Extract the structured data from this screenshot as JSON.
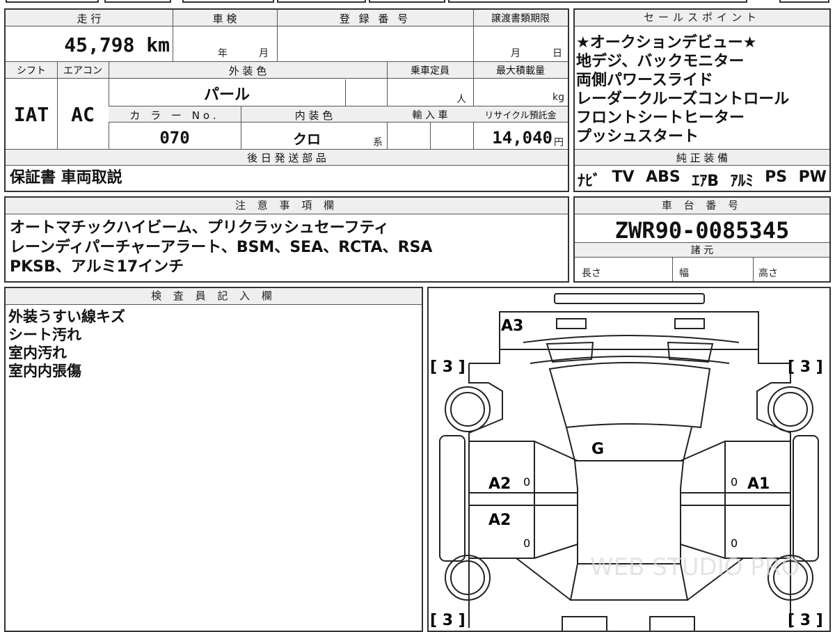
{
  "top_strip": {
    "title_fragment": "■■■"
  },
  "spec": {
    "mileage_label": "走 行",
    "mileage": "45,798 km",
    "inspection_label": "車 検",
    "inspection_year": "年",
    "inspection_month": "月",
    "registration_label": "登 録 番 号",
    "transfer_label": "譲渡書類期限",
    "transfer_month": "月",
    "transfer_day": "日",
    "shift_label": "シフト",
    "shift": "IAT",
    "ac_label": "エアコン",
    "ac": "AC",
    "exterior_label": "外 装 色",
    "exterior": "パール",
    "capacity_label": "乗車定員",
    "capacity_unit": "人",
    "max_load_label": "最大積載量",
    "max_load_unit": "kg",
    "color_no_label": "カ ラ ー No.",
    "color_no": "070",
    "interior_label": "内 装 色",
    "interior": "クロ",
    "interior_suffix": "系",
    "import_label": "輸 入 車",
    "recycle_label": "リサイクル預託金",
    "recycle_value": "14,040",
    "recycle_unit": "円"
  },
  "later_parts": {
    "label": "後 日 発 送 部 品",
    "value": "保証書 車両取説"
  },
  "sales": {
    "label": "セールスポイント",
    "lines": [
      "★オークションデビュー★",
      "地デジ、バックモニター",
      "両側パワースライド",
      "レーダークルーズコントロール",
      "フロントシートヒーター",
      "プッシュスタート"
    ]
  },
  "equipment": {
    "label": "純 正 装 備",
    "items": [
      "ﾅﾋﾞ",
      "TV",
      "ABS",
      "ｴｱB",
      "ｱﾙﾐ",
      "PS",
      "PW"
    ]
  },
  "notes": {
    "label": "注 意 事 項 欄",
    "lines": [
      "オートマチックハイビーム、プリクラッシュセーフティ",
      "レーンディパーチャーアラート、BSM、SEA、RCTA、RSA",
      "PKSB、アルミ17インチ"
    ]
  },
  "chassis": {
    "label": "車 台 番 号",
    "number": "ZWR90-0085345",
    "specs_label": "諸 元",
    "length_label": "長さ",
    "width_label": "幅",
    "height_label": "高さ"
  },
  "inspector": {
    "label": "検 査 員 記 入 欄",
    "lines": [
      "外装うすい線キズ",
      "シート汚れ",
      "室内汚れ",
      "室内内張傷"
    ]
  },
  "diagram": {
    "marks": {
      "rear": "A3",
      "roof": "G",
      "left_front_door": "A2",
      "left_rear_door": "A2",
      "right_front_door": "A1",
      "tire_fl": "[ 3 ]",
      "tire_fr": "[ 3 ]",
      "tire_rl": "[ 3 ]",
      "tire_rr": "[ 3 ]",
      "zero": "0"
    },
    "watermark": "WEB STUDIO PRO"
  }
}
